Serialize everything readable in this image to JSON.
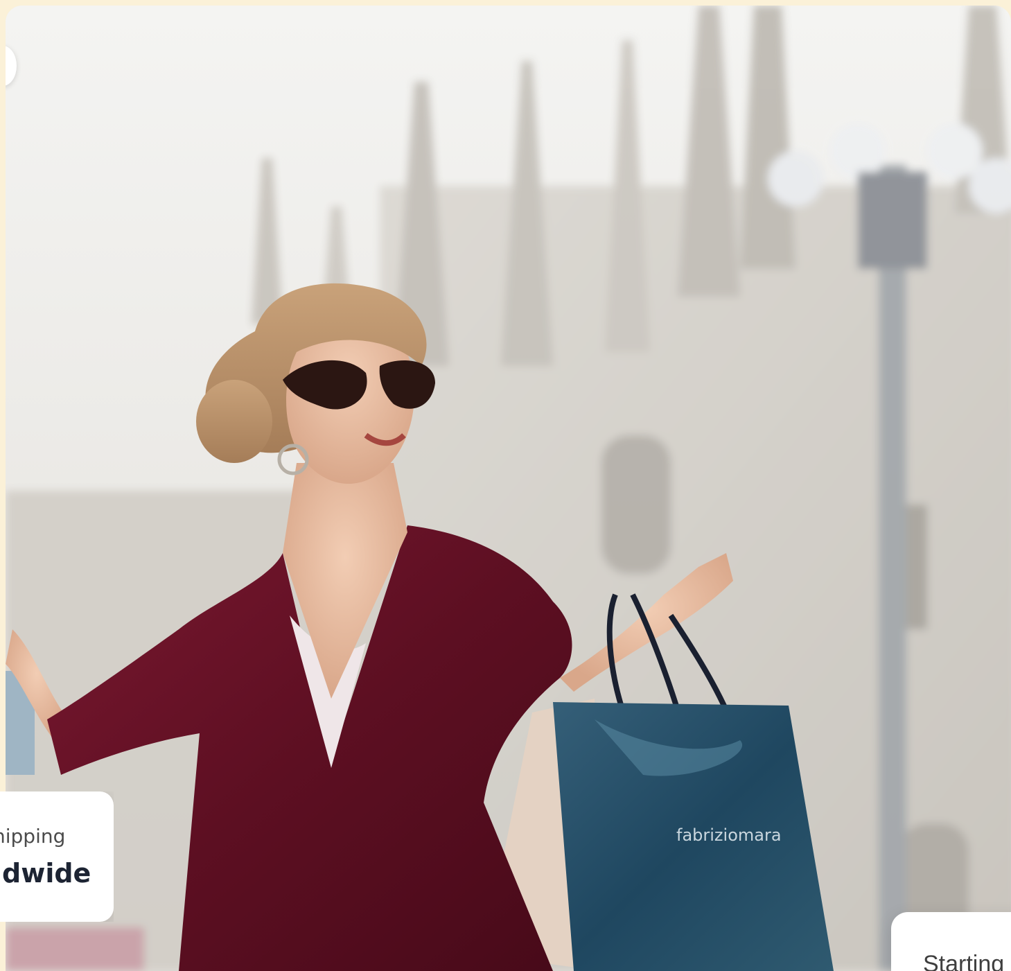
{
  "hero": {
    "image_alt": "Woman in burgundy velvet dress holding shopping bags in front of a cathedral",
    "bag_brand": "fabriziomara"
  },
  "shipping_card": {
    "label": "hipping",
    "value": "ldwide"
  },
  "price_card": {
    "label": "Starting"
  },
  "colors": {
    "page_background": "#fbf1d8",
    "card_background": "#ffffff",
    "dress": "#6b1126",
    "bag": "#244b63"
  }
}
